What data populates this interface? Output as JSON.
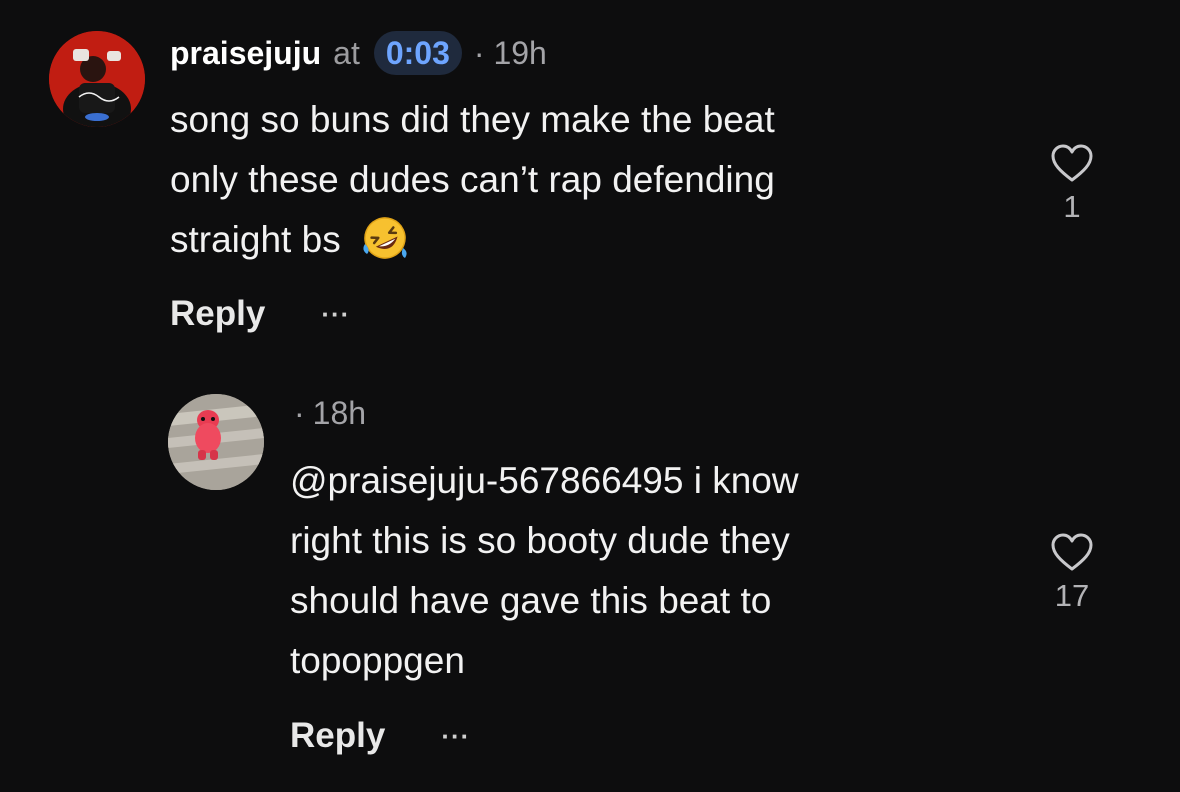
{
  "comments": [
    {
      "username": "praisejuju",
      "at_word": "at",
      "timestamp": "0:03",
      "dot": "·",
      "age": "19h",
      "lines": [
        "song so buns did they make the beat",
        "only these dudes can’t rap defending",
        "straight bs"
      ],
      "emoji": "rolling-on-floor-laughing",
      "reply_label": "Reply",
      "more_label": "···",
      "like_count": "1"
    },
    {
      "dot": "·",
      "age": "18h",
      "lines": [
        "@praisejuju-567866495 i know",
        "right this is so booty dude they",
        "should have gave this beat to",
        "topoppgen"
      ],
      "reply_label": "Reply",
      "more_label": "···",
      "like_count": "17"
    }
  ],
  "colors": {
    "background": "#0d0d0e",
    "timestamp_accent": "#6ea5ff",
    "muted_text": "#a4a4a8"
  },
  "icons": {
    "like": "heart-outline-icon",
    "more": "ellipsis-icon"
  }
}
